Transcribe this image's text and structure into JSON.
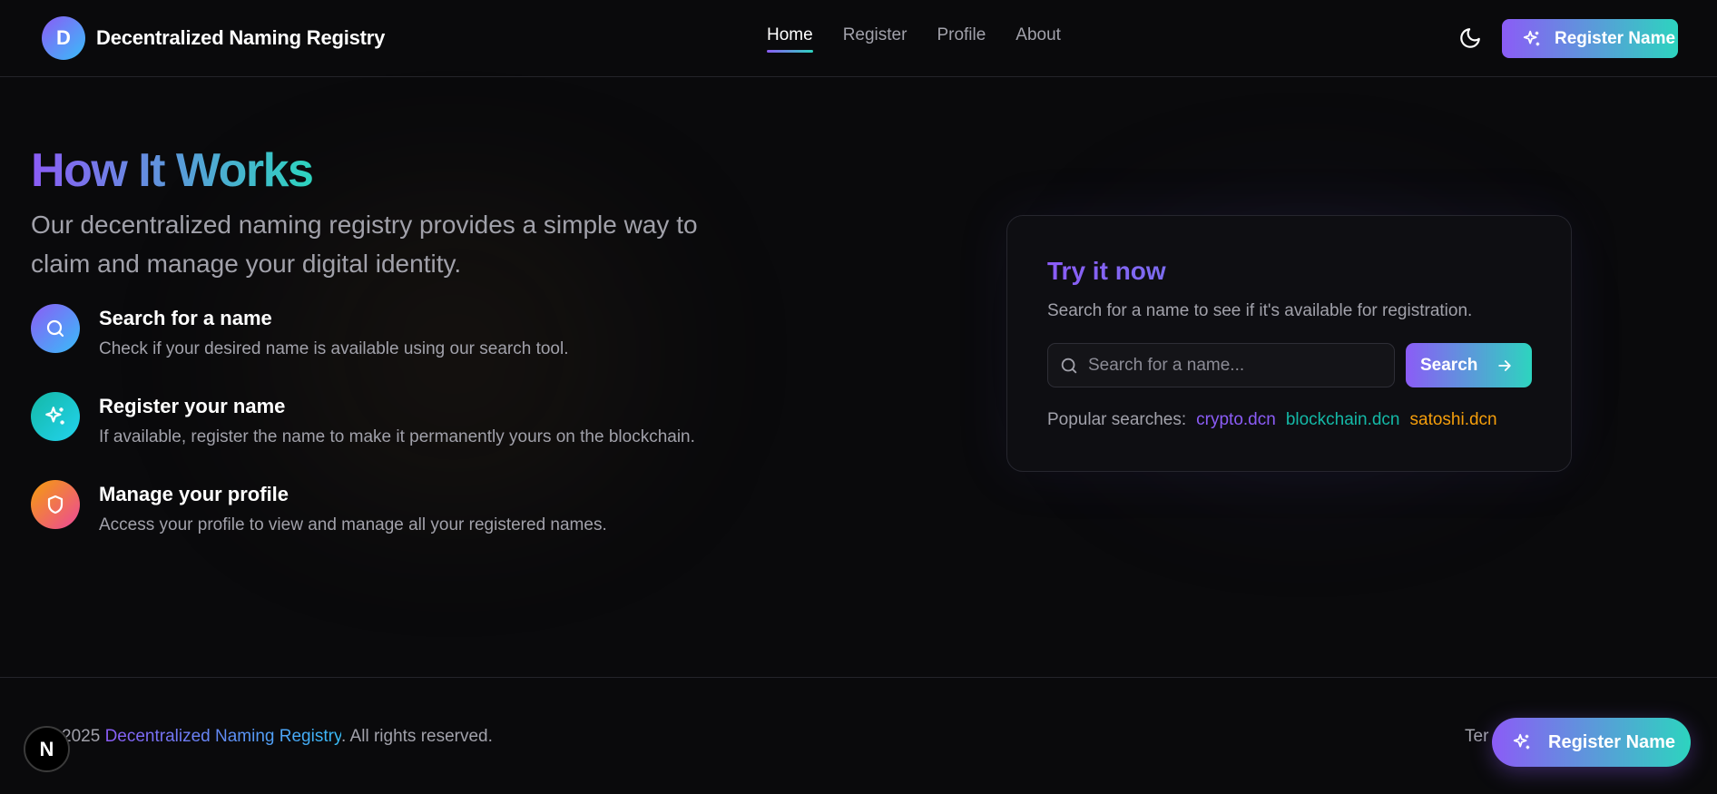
{
  "header": {
    "logo_letter": "D",
    "brand": "Decentralized Naming Registry",
    "nav": [
      {
        "label": "Home",
        "active": true
      },
      {
        "label": "Register",
        "active": false
      },
      {
        "label": "Profile",
        "active": false
      },
      {
        "label": "About",
        "active": false
      }
    ],
    "theme_icon": "moon-icon",
    "cta_label": "Register Name"
  },
  "hero": {
    "title": "How It Works",
    "subtitle": "Our decentralized naming registry provides a simple way to claim and manage your digital identity."
  },
  "steps": [
    {
      "icon": "search-icon",
      "title": "Search for a name",
      "description": "Check if your desired name is available using our search tool."
    },
    {
      "icon": "sparkles-icon",
      "title": "Register your name",
      "description": "If available, register the name to make it permanently yours on the blockchain."
    },
    {
      "icon": "shield-icon",
      "title": "Manage your profile",
      "description": "Access your profile to view and manage all your registered names."
    }
  ],
  "try_card": {
    "title": "Try it now",
    "subtitle": "Search for a name to see if it's available for registration.",
    "search_placeholder": "Search for a name...",
    "search_value": "",
    "search_button": "Search",
    "popular_label": "Popular searches:",
    "popular": [
      "crypto.dcn",
      "blockchain.dcn",
      "satoshi.dcn"
    ]
  },
  "footer": {
    "copyright_prefix": "2025",
    "copyright_brand": "Decentralized Naming Registry",
    "copyright_suffix": ". All rights reserved.",
    "terms_fragment": "Ter",
    "next_badge": "N",
    "floating_cta": "Register Name"
  },
  "colors": {
    "accent_start": "#8b5cf6",
    "accent_end": "#2dd4bf",
    "background": "#0a0a0c",
    "popular_1": "#8b5cf6",
    "popular_2": "#14b8a6",
    "popular_3": "#f59e0b"
  }
}
